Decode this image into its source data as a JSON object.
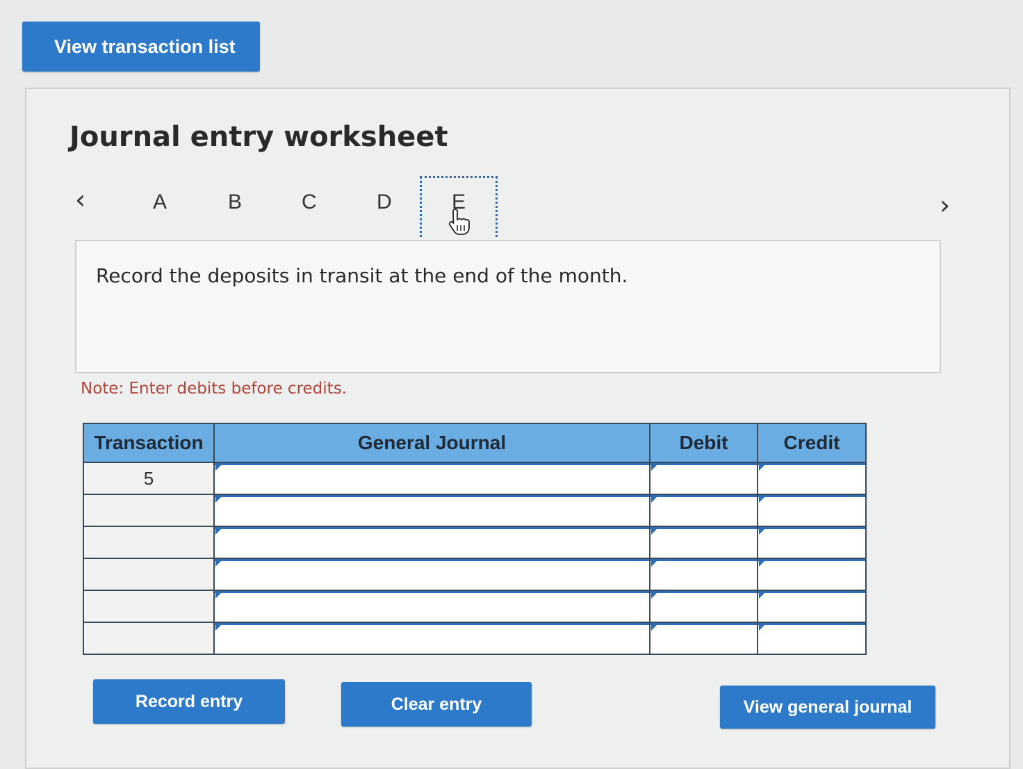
{
  "header": {
    "view_transaction_list_label": "View transaction list"
  },
  "worksheet": {
    "title": "Journal entry worksheet",
    "nav": {
      "prev_icon": "chevron-left-icon",
      "next_icon": "chevron-right-icon",
      "prev_glyph": "‹",
      "next_glyph": "›"
    },
    "tabs": [
      {
        "label": "A",
        "active": false
      },
      {
        "label": "B",
        "active": false
      },
      {
        "label": "C",
        "active": false
      },
      {
        "label": "D",
        "active": false
      },
      {
        "label": "E",
        "active": true
      }
    ],
    "instruction": "Record the deposits in transit at the end of the month.",
    "note": "Note: Enter debits before credits."
  },
  "journal_table": {
    "headers": [
      "Transaction",
      "General Journal",
      "Debit",
      "Credit"
    ],
    "rows": [
      {
        "transaction": "5",
        "account": "",
        "debit": "",
        "credit": ""
      },
      {
        "transaction": "",
        "account": "",
        "debit": "",
        "credit": ""
      },
      {
        "transaction": "",
        "account": "",
        "debit": "",
        "credit": ""
      },
      {
        "transaction": "",
        "account": "",
        "debit": "",
        "credit": ""
      },
      {
        "transaction": "",
        "account": "",
        "debit": "",
        "credit": ""
      },
      {
        "transaction": "",
        "account": "",
        "debit": "",
        "credit": ""
      }
    ]
  },
  "actions": {
    "record_entry_label": "Record entry",
    "clear_entry_label": "Clear entry",
    "view_general_journal_label": "View general journal"
  },
  "colors": {
    "button_blue": "#2c7ac9",
    "table_header_blue": "#69ade2",
    "note_red": "#b0453a",
    "active_tab_outline": "#2c6db5"
  }
}
